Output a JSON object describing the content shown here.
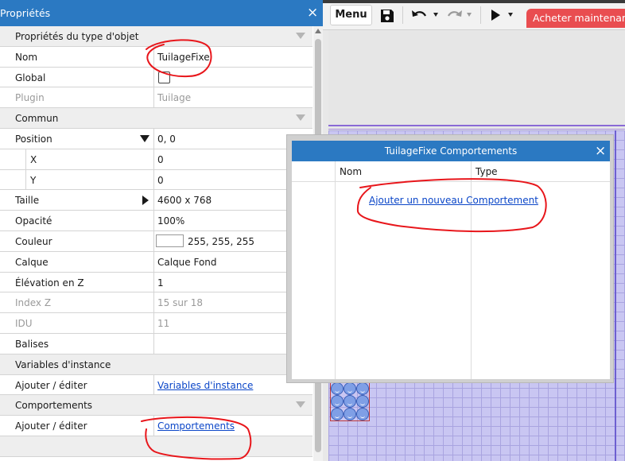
{
  "properties_panel": {
    "title": "Propriétés",
    "close_glyph": "×",
    "rows": {
      "type_props": "Propriétés du type d'objet",
      "name_label": "Nom",
      "name_value": "TuilageFixe",
      "global_label": "Global",
      "plugin_label": "Plugin",
      "plugin_value": "Tuilage",
      "common": "Commun",
      "position_label": "Position",
      "position_value": "0, 0",
      "x_label": "X",
      "x_value": "0",
      "y_label": "Y",
      "y_value": "0",
      "size_label": "Taille",
      "size_value": "4600 x 768",
      "opacity_label": "Opacité",
      "opacity_value": "100%",
      "color_label": "Couleur",
      "color_value": "255, 255, 255",
      "layer_label": "Calque",
      "layer_value": "Calque Fond",
      "zelev_label": "Élévation en Z",
      "zelev_value": "1",
      "zindex_label": "Index Z",
      "zindex_value": "15 sur 18",
      "uid_label": "IDU",
      "uid_value": "11",
      "tags_label": "Balises",
      "instance_vars": "Variables d'instance",
      "add_edit_1": "Ajouter / éditer",
      "instance_vars_link": "Variables d'instance",
      "behaviors": "Comportements",
      "add_edit_2": "Ajouter / éditer",
      "behaviors_link": "Comportements"
    }
  },
  "toolbar": {
    "menu_label": "Menu",
    "buy_label": "Acheter maintenant"
  },
  "icons": [
    "save-icon",
    "undo-icon",
    "redo-icon",
    "play-icon",
    "close-icon",
    "chevron-down-icon"
  ],
  "dialog": {
    "title": "TuilageFixe Comportements",
    "close_glyph": "×",
    "col_name": "Nom",
    "col_type": "Type",
    "add_behavior_link": "Ajouter un nouveau Comportement"
  },
  "colors": {
    "titlebar_blue": "#2b79c2",
    "buy_red": "#e94d50",
    "link_blue": "#0b46c8",
    "annotation_red": "#e8161b",
    "scene_grid": "#c9c6f2"
  }
}
